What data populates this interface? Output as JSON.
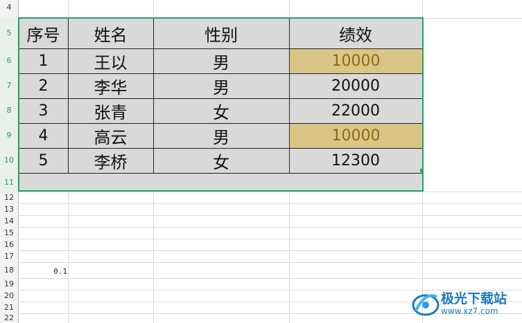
{
  "row_numbers": [
    "4",
    "5",
    "6",
    "7",
    "8",
    "9",
    "10",
    "11",
    "12",
    "13",
    "14",
    "15",
    "16",
    "17",
    "18",
    "19",
    "20",
    "21",
    "22"
  ],
  "table": {
    "headers": [
      "序号",
      "姓名",
      "性别",
      "绩效"
    ],
    "rows": [
      {
        "seq": "1",
        "name": "王以",
        "gender": "男",
        "perf": "10000",
        "highlight": true
      },
      {
        "seq": "2",
        "name": "李华",
        "gender": "男",
        "perf": "20000",
        "highlight": false
      },
      {
        "seq": "3",
        "name": "张青",
        "gender": "女",
        "perf": "22000",
        "highlight": false
      },
      {
        "seq": "4",
        "name": "高云",
        "gender": "男",
        "perf": "10000",
        "highlight": true
      },
      {
        "seq": "5",
        "name": "李桥",
        "gender": "女",
        "perf": "12300",
        "highlight": false
      }
    ]
  },
  "cell_B18": "0.1",
  "watermark": {
    "text": "极光下载站",
    "url": "www.xz7.com"
  },
  "colors": {
    "selection": "#21a366",
    "highlight_fill": "#d9c686",
    "highlight_text": "#8a6a14",
    "table_fill": "#d9d9d9"
  }
}
